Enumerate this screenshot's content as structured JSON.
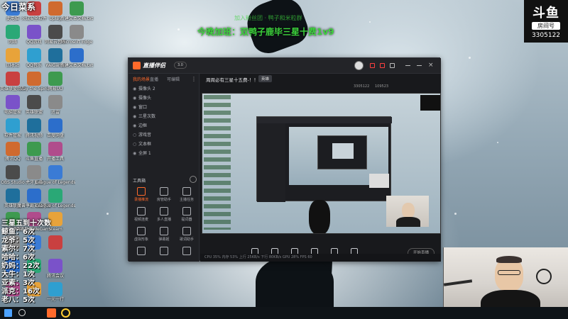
{
  "desktop": {
    "icons_col1": [
      "此电脑",
      "网络",
      "回收站",
      "英雄联盟助手",
      "电脑管家",
      "软件管家",
      "腾讯QQ",
      "OBS Studio",
      "英雄联盟",
      "远程桌面",
      "",
      "",
      ""
    ],
    "icons_col2": [
      "火绒安全软件",
      "QQ游戏",
      "QQ音乐",
      "Slay the Spire",
      "英雄联盟",
      "腾讯视频",
      "斗鱼直播",
      "虎牙直播",
      "魔兽争霸对战平台",
      "英雄联盟WeGame",
      "",
      "",
      ""
    ],
    "icons_col3": [
      "Uplay",
      "网易云音乐",
      "WeGame",
      "网易UU",
      "迅雷",
      "百度网盘",
      "开播工具",
      "League of Legends",
      "League of Legends",
      "Steam",
      "",
      "腾讯会议",
      "一元一行"
    ],
    "icons_col4": [
      "新建文本文档.txt",
      "Microsoft Edge",
      "新建文本文档.txt",
      "",
      "",
      "",
      "",
      "",
      "",
      "",
      "",
      "",
      ""
    ]
  },
  "overlay": {
    "top_left": "今日菜系",
    "banner_main": "今晚加班：双鸭子鹿毕三星十费1v9",
    "banner_sub": "加入粉丝团 · 鸭子和米粒群",
    "stats": [
      {
        "name": "鲸鱼",
        "value": "6次"
      },
      {
        "name": "龙爷",
        "value": "5次"
      },
      {
        "name": "索尔",
        "value": "7次"
      },
      {
        "name": "哈哈",
        "value": "6次"
      },
      {
        "name": "奶妈",
        "value": "22次"
      },
      {
        "name": "大牛",
        "value": "1次"
      },
      {
        "name": "亚索",
        "value": "3次"
      },
      {
        "name": "派克",
        "value": "16次"
      },
      {
        "name": "老八",
        "value": "5次"
      }
    ],
    "stats_header": "三星五到十次数"
  },
  "brand": {
    "logo": "斗鱼",
    "subtitle": "房间号",
    "room_number": "3305122"
  },
  "app": {
    "title": "直播伴侣",
    "version": "3.0",
    "tabs": [
      "我的场景",
      "直播",
      "可编辑"
    ],
    "layers": [
      {
        "label": "摄像头 2",
        "visible": true
      },
      {
        "label": "摄像头",
        "visible": true
      },
      {
        "label": "窗口",
        "visible": true
      },
      {
        "label": "三星次数",
        "visible": true
      },
      {
        "label": "边框",
        "visible": true
      },
      {
        "label": "游戏音",
        "visible": false
      },
      {
        "label": "文本框",
        "visible": false
      },
      {
        "label": "全屏 1",
        "visible": true
      }
    ],
    "tools_header": "工具箱",
    "tools": [
      "录播推流",
      "房管助手",
      "主播任务",
      "视频连麦",
      "多人直播",
      "提词器",
      "虚拟形象",
      "弹幕姬",
      "歌词助手",
      "",
      "",
      ""
    ],
    "stream_title": "周周必有三星十五费-！！",
    "stream_tag": "英雄",
    "room_info": "3305122",
    "hot_value": "109523",
    "bottom_buttons": [
      "直播屏幕",
      "摄像头",
      "手机投屏",
      "多媒体",
      "麦克风",
      "扬声器"
    ],
    "start_button": "开始直播",
    "status_text": "CPU 35%  内存 53%  上行 25KB/s  下行 80KB/s  GPU 28%  FPS 60"
  },
  "colors": {
    "accent": "#ff6a2b",
    "banner_green": "#3dd43d",
    "stat_green": "#6cf06a"
  }
}
